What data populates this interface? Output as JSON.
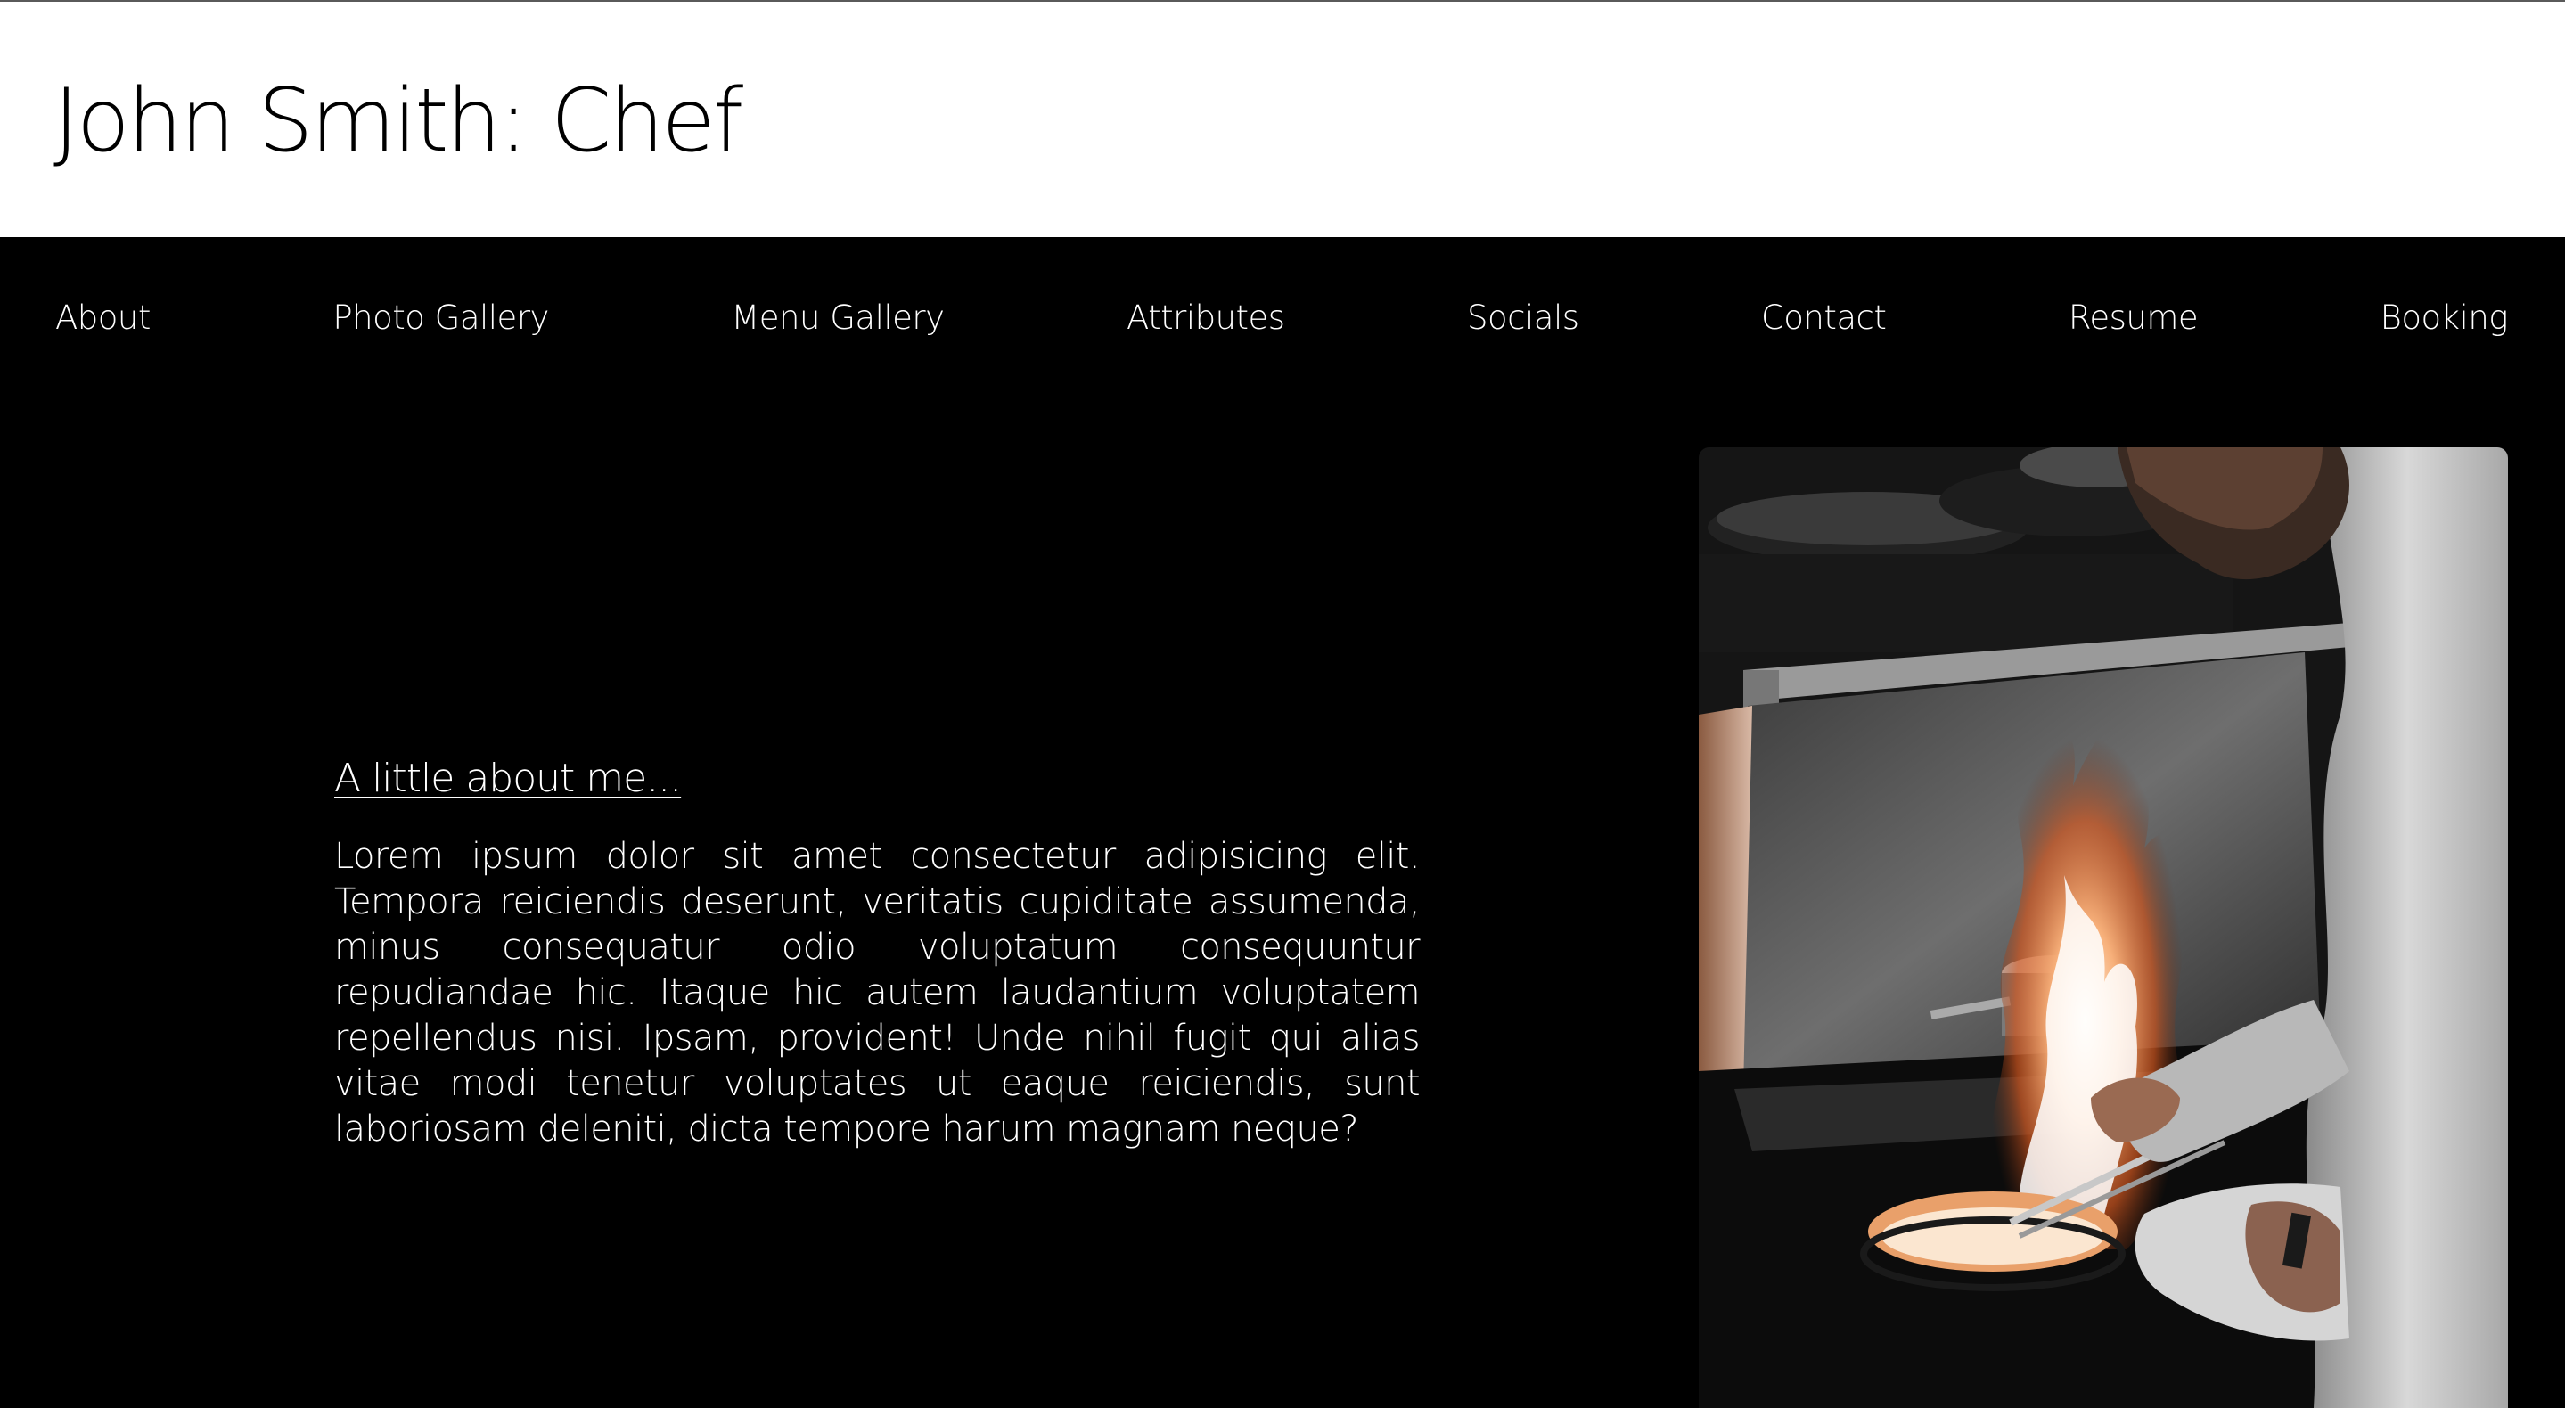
{
  "header": {
    "title": "John Smith: Chef"
  },
  "nav": {
    "items": [
      {
        "label": "About"
      },
      {
        "label": "Photo Gallery"
      },
      {
        "label": "Menu Gallery"
      },
      {
        "label": "Attributes"
      },
      {
        "label": "Socials"
      },
      {
        "label": "Contact"
      },
      {
        "label": "Resume"
      },
      {
        "label": "Booking"
      }
    ]
  },
  "about": {
    "heading": "A little about me...",
    "body": "Lorem ipsum dolor sit amet consectetur adipisicing elit. Tempora reiciendis deserunt, veritatis cupiditate assumenda, minus consequatur odio voluptatum consequuntur repudiandae hic. Itaque hic autem laudantium voluptatem repellendus nisi. Ipsam, provident! Unde nihil fugit qui alias vitae modi tenetur voluptates ut eaque reiciendis, sunt laboriosam deleniti, dicta tempore harum magnam neque?"
  },
  "colors": {
    "page_background": "#000000",
    "header_background": "#ffffff",
    "nav_text": "#ffffff",
    "flame_accent": "#e8703a"
  }
}
